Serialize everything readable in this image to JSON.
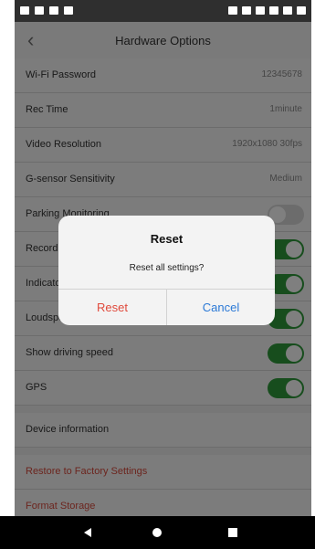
{
  "header": {
    "title": "Hardware Options",
    "back_icon": "chevron-left-icon"
  },
  "settings": [
    {
      "label": "Wi-Fi Password",
      "value": "12345678"
    },
    {
      "label": "Rec Time",
      "value": "1minute"
    },
    {
      "label": "Video Resolution",
      "value": "1920x1080 30fps"
    },
    {
      "label": "G-sensor Sensitivity",
      "value": "Medium"
    },
    {
      "label": "Parking Monitoring",
      "value": ""
    },
    {
      "label": "Record",
      "value": ""
    },
    {
      "label": "Indicator",
      "value": ""
    },
    {
      "label": "Loudspeaker",
      "value": ""
    },
    {
      "label": "Show driving speed",
      "value": ""
    },
    {
      "label": "GPS",
      "value": ""
    },
    {
      "label": "Device information",
      "value": ""
    },
    {
      "label": "Restore to Factory Settings",
      "value": ""
    },
    {
      "label": "Format Storage",
      "value": ""
    }
  ],
  "dialog": {
    "title": "Reset",
    "message": "Reset all settings?",
    "reset_label": "Reset",
    "cancel_label": "Cancel"
  },
  "colors": {
    "accent_green": "#2f9b3b",
    "danger_red": "#d84b3d",
    "link_blue": "#2b79d6"
  },
  "nav": {
    "back_icon": "nav-back-icon",
    "home_icon": "nav-home-icon",
    "recent_icon": "nav-recent-apps-icon"
  }
}
